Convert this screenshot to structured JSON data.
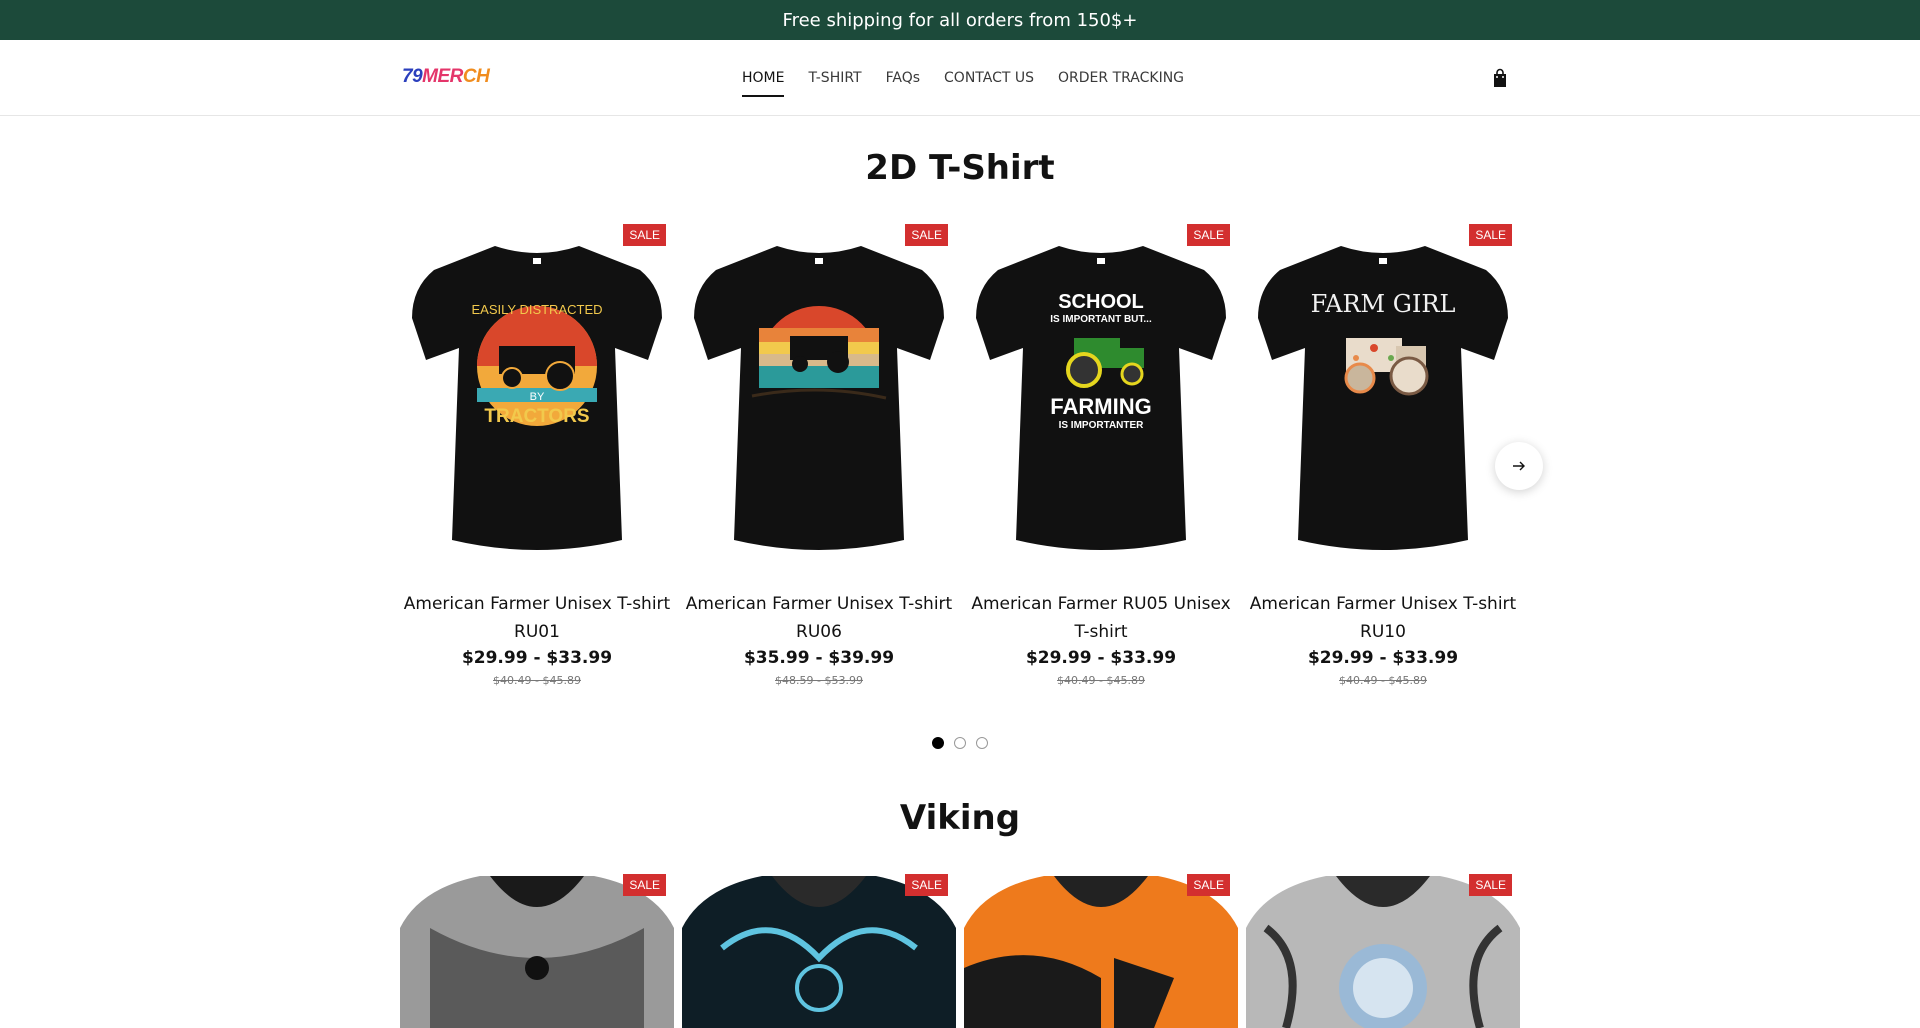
{
  "announcement": {
    "text": "Free shipping for all orders from 150$+"
  },
  "header": {
    "logo_parts": [
      "79",
      "MER",
      "CH"
    ],
    "nav": [
      {
        "label": "HOME",
        "active": true
      },
      {
        "label": "T-SHIRT"
      },
      {
        "label": "FAQs"
      },
      {
        "label": "CONTACT US"
      },
      {
        "label": "ORDER TRACKING"
      }
    ]
  },
  "sections": [
    {
      "title": "2D T-Shirt",
      "products": [
        {
          "title": "American Farmer Unisex T-shirt RU01",
          "price": "$29.99 - $33.99",
          "compare_price": "$40.49 - $45.89",
          "badge": "SALE"
        },
        {
          "title": "American Farmer Unisex T-shirt RU06",
          "price": "$35.99 - $39.99",
          "compare_price": "$48.59 - $53.99",
          "badge": "SALE"
        },
        {
          "title": "American Farmer RU05 Unisex T-shirt",
          "price": "$29.99 - $33.99",
          "compare_price": "$40.49 - $45.89",
          "badge": "SALE"
        },
        {
          "title": "American Farmer Unisex T-shirt RU10",
          "price": "$29.99 - $33.99",
          "compare_price": "$40.49 - $45.89",
          "badge": "SALE"
        }
      ],
      "pagination": {
        "pages": 3,
        "current": 1
      }
    },
    {
      "title": "Viking",
      "products": [
        {
          "badge": "SALE"
        },
        {
          "badge": "SALE"
        },
        {
          "badge": "SALE"
        },
        {
          "badge": "SALE"
        }
      ]
    }
  ],
  "icons": {
    "cart": "shopping-bag-icon",
    "next": "arrow-right-icon"
  },
  "colors": {
    "announcement_bg": "#1c4a3a",
    "sale_badge": "#d32f2f"
  },
  "shirt_graphics": [
    {
      "lines": [
        "EASILY DISTRACTED",
        "BY",
        "TRACTORS"
      ]
    },
    {
      "lines": []
    },
    {
      "lines": [
        "SCHOOL",
        "IS IMPORTANT BUT...",
        "FARMING",
        "IS IMPORTANTER"
      ]
    },
    {
      "lines": [
        "FARM GIRL"
      ]
    }
  ]
}
